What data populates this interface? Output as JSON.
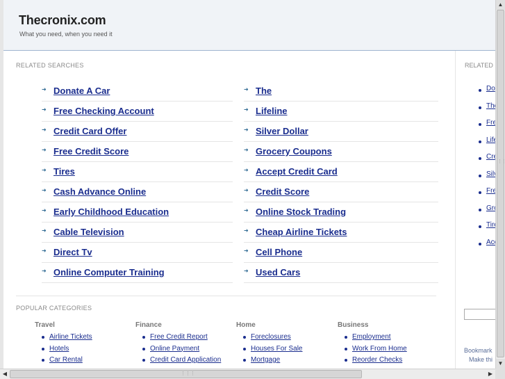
{
  "header": {
    "title": "Thecronix.com",
    "tagline": "What you need, when you need it"
  },
  "related_searches": {
    "label": "RELATED SEARCHES",
    "left": [
      "Donate A Car",
      "Free Checking Account",
      "Credit Card Offer",
      "Free Credit Score",
      "Tires",
      "Cash Advance Online",
      "Early Childhood Education",
      "Cable Television",
      "Direct Tv",
      "Online Computer Training"
    ],
    "right": [
      "The",
      "Lifeline",
      "Silver Dollar",
      "Grocery Coupons",
      "Accept Credit Card",
      "Credit Score",
      "Online Stock Trading",
      "Cheap Airline Tickets",
      "Cell Phone",
      "Used Cars"
    ]
  },
  "popular_categories": {
    "label": "POPULAR CATEGORIES",
    "groups": [
      {
        "title": "Travel",
        "links": [
          "Airline Tickets",
          "Hotels",
          "Car Rental"
        ]
      },
      {
        "title": "Finance",
        "links": [
          "Free Credit Report",
          "Online Payment",
          "Credit Card Application"
        ]
      },
      {
        "title": "Home",
        "links": [
          "Foreclosures",
          "Houses For Sale",
          "Mortgage"
        ]
      },
      {
        "title": "Business",
        "links": [
          "Employment",
          "Work From Home",
          "Reorder Checks"
        ]
      }
    ]
  },
  "sidebar": {
    "label": "RELATED",
    "items": [
      "Do",
      "The",
      "Fre",
      "Life",
      "Cre",
      "Silv",
      "Fre",
      "Gro",
      "Tire",
      "Acc"
    ],
    "bookmark": "Bookmark",
    "make": "Make thi"
  },
  "icons": {
    "arrow": "arrow-right-icon",
    "bullet": "bullet-icon"
  },
  "colors": {
    "link": "#1a2d8e",
    "header_bg": "#f0f3f7",
    "header_border": "#9fb4d0"
  }
}
